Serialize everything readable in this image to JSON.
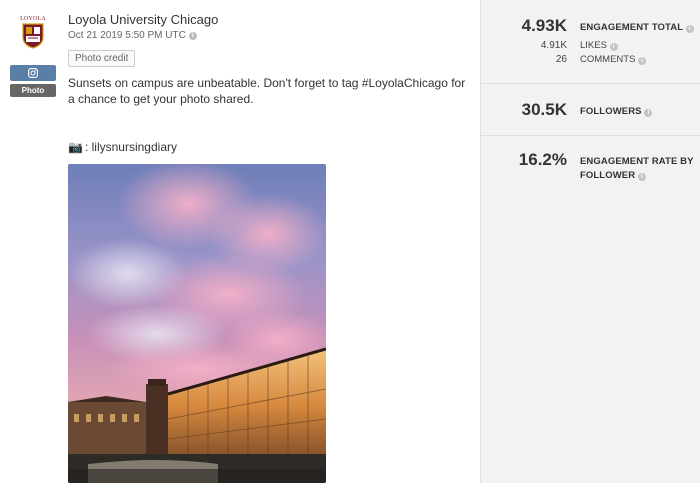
{
  "post": {
    "logo_text": "LOYOLA",
    "instagram_icon": "instagram-icon",
    "type_badge": "Photo",
    "author": "Loyola University Chicago",
    "timestamp": "Oct 21 2019 5:50 PM UTC",
    "photo_credit_button": "Photo credit",
    "caption": "Sunsets on campus are unbeatable. Don't forget to tag #LoyolaChicago for a chance to get your photo shared.",
    "credit_prefix": "📷",
    "credit_handle": ": lilysnursingdiary"
  },
  "stats": {
    "engagement_total": {
      "value": "4.93K",
      "label": "ENGAGEMENT TOTAL"
    },
    "likes": {
      "value": "4.91K",
      "label": "LIKES"
    },
    "comments": {
      "value": "26",
      "label": "COMMENTS"
    },
    "followers": {
      "value": "30.5K",
      "label": "FOLLOWERS"
    },
    "engagement_rate": {
      "value": "16.2%",
      "label_line1": "ENGAGEMENT RATE BY",
      "label_line2": "FOLLOWER"
    },
    "info_glyph": "i"
  },
  "colors": {
    "instagram_badge": "#5a7fa6",
    "photo_badge": "#666666",
    "panel_bg": "#f2f2f2",
    "logo_maroon": "#7a1a2b",
    "logo_gold": "#d4a017"
  }
}
